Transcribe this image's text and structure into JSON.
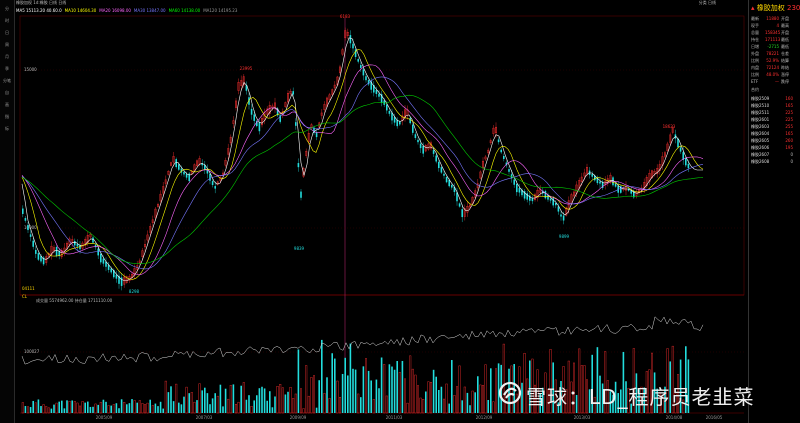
{
  "header": {
    "title": "橡胶加权 1d:橡胶 日线 日线",
    "period": "日线",
    "ma_labels": [
      {
        "text": "MA5 15113.20 40.60.0",
        "color": "#ffffff"
      },
      {
        "text": "MA10 14604.30",
        "color": "#ffff00"
      },
      {
        "text": "MA20 16098.00",
        "color": "#ff66ff"
      },
      {
        "text": "MA30 13847.00",
        "color": "#7777ff"
      },
      {
        "text": "MA60 14138.00",
        "color": "#00ff00"
      },
      {
        "text": "MA120 14195.23",
        "color": "#999999"
      }
    ],
    "top_right_label": "分类 日线"
  },
  "chart_data": {
    "type": "candlestick",
    "price_labels": {
      "high": "6183",
      "low1": "8298",
      "low2": "9839",
      "mid1": "23995",
      "right_high": "18623",
      "low3": "9899"
    },
    "y_ticks": [
      "10000",
      "15000"
    ],
    "x_ticks": [
      "2005/09",
      "2007/03",
      "2009/09",
      "2011/03",
      "2012/09",
      "2013/03",
      "2014/08",
      "2016/05"
    ],
    "volume_header": "成交量 5574962.00  持仓量 1711110.00",
    "volume_y_tick": "100027",
    "subpanel_label": "CL",
    "subpanel_value": "04111"
  },
  "quote_panel": {
    "title": "橡胶加权",
    "price": "230",
    "rows": [
      {
        "k": "最新",
        "v": "11880",
        "k2": "开盘"
      },
      {
        "k": "现手",
        "v": "4",
        "k2": "最高"
      },
      {
        "k": "总量",
        "v": "158345",
        "k2": "开盘"
      },
      {
        "k": "持仓",
        "v": "171113",
        "k2": "最低"
      },
      {
        "k": "日增",
        "v": "-2715",
        "k2": "最低"
      },
      {
        "k": "外盘",
        "v": "78221",
        "k2": "仓差"
      },
      {
        "k": "比例",
        "v": "52.9%",
        "k2": "结算"
      },
      {
        "k": "内盘",
        "v": "72124",
        "k2": "昨结"
      },
      {
        "k": "比例",
        "v": "48.0%",
        "k2": "涨停"
      },
      {
        "k": "ETF",
        "v": "—",
        "k2": "跌停"
      }
    ],
    "contracts_header": "合约",
    "contracts": [
      {
        "n": "橡胶2509",
        "p": "160"
      },
      {
        "n": "橡胶2510",
        "p": "165"
      },
      {
        "n": "橡胶2511",
        "p": "225"
      },
      {
        "n": "橡胶2601",
        "p": "225"
      },
      {
        "n": "橡胶2603",
        "p": "255"
      },
      {
        "n": "橡胶2604",
        "p": "165"
      },
      {
        "n": "橡胶2605",
        "p": "260"
      },
      {
        "n": "橡胶2606",
        "p": "195"
      },
      {
        "n": "橡胶2607",
        "p": "0"
      },
      {
        "n": "橡胶2608",
        "p": "0"
      }
    ]
  },
  "toolbar": {
    "items": [
      "分",
      "时",
      "日",
      "周",
      "月",
      "季",
      "分笔",
      "自",
      "画",
      "指",
      "标"
    ]
  },
  "watermark": "雪球：LD_程序员老韭菜",
  "colors": {
    "up": "#ff3030",
    "down": "#22dddd",
    "bg": "#000000",
    "grid": "#3a0000"
  }
}
